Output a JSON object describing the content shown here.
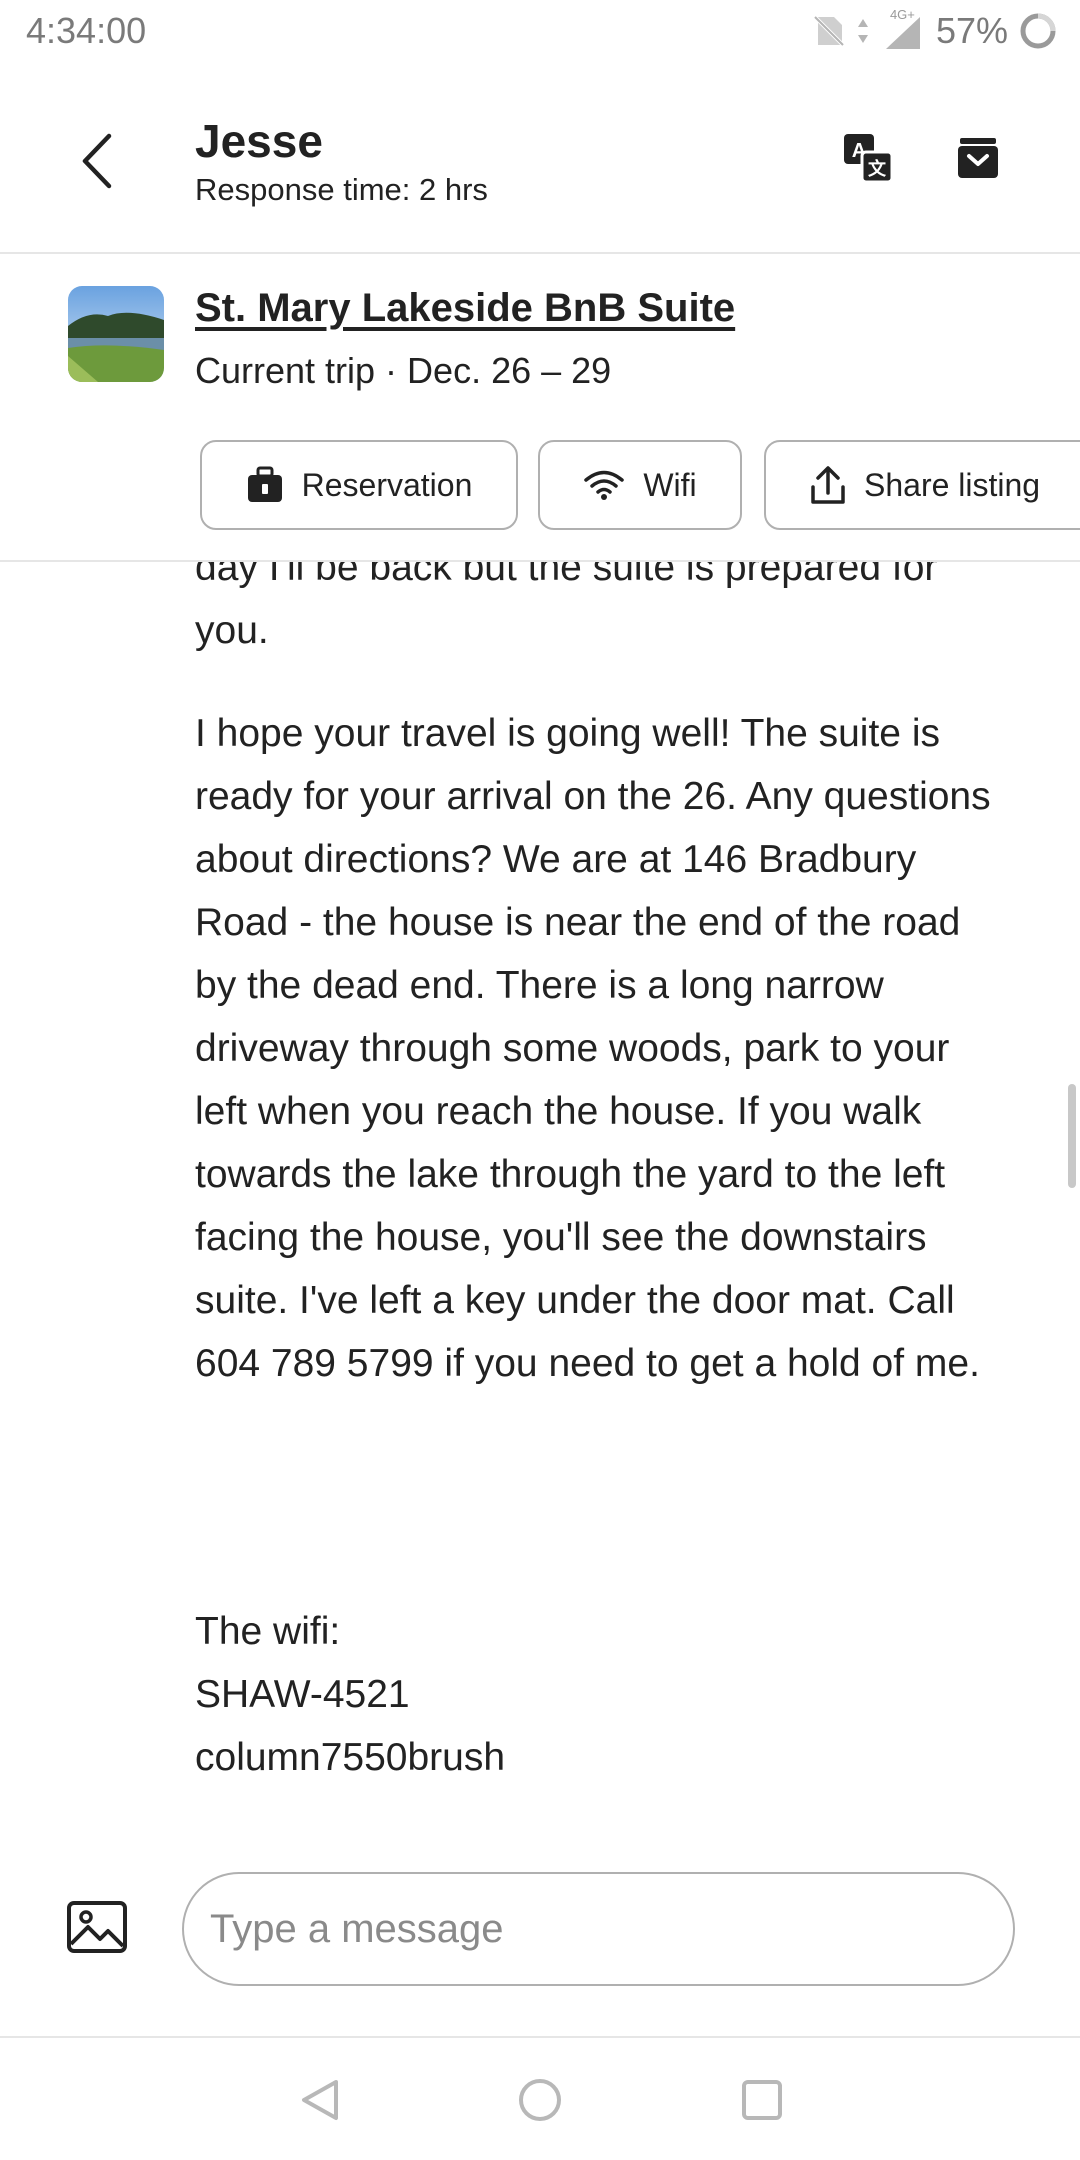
{
  "status_bar": {
    "time": "4:34:00",
    "network": "4G+",
    "battery": "57%"
  },
  "header": {
    "host_name": "Jesse",
    "response_time": "Response time: 2 hrs",
    "icons": [
      "back-arrow-icon",
      "translate-icon",
      "archive-icon"
    ]
  },
  "listing": {
    "title": "St. Mary Lakeside BnB Suite",
    "trip": "Current trip · Dec. 26 – 29",
    "actions": {
      "reservation": "Reservation",
      "wifi": "Wifi",
      "share": "Share listing"
    }
  },
  "messages": {
    "previous_tail": "day I'll be back but the suite is prepared for you.",
    "main": "I hope your travel is going well! The suite is ready for your arrival on the 26. Any questions about directions? We are at 146 Bradbury Road - the house is near the end of the road by the dead end. There is a long narrow driveway through some woods, park to your left when you reach the house. If you walk towards the lake through the yard to the left facing the house, you'll see the downstairs suite. I've left a key under the door mat. Call 604 789 5799 if you need to get a hold of me.",
    "wifi_heading": "The wifi:",
    "wifi_network": "SHAW-4521",
    "wifi_password": "column7550brush"
  },
  "composer": {
    "placeholder": "Type a message"
  },
  "colors": {
    "text": "#222222",
    "muted": "#7a7a7a",
    "border": "#b0b0b0",
    "divider": "#e6e6e6"
  }
}
